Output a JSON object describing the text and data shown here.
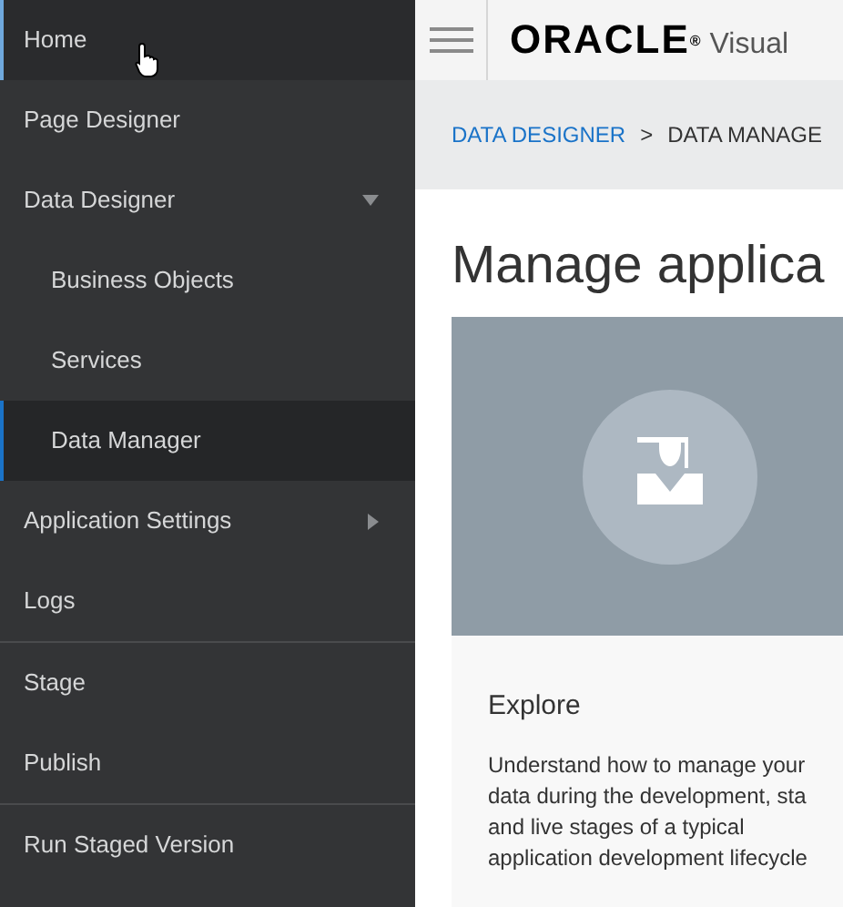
{
  "sidebar": {
    "groups": [
      [
        {
          "label": "Home",
          "hovered": true,
          "selected": false
        },
        {
          "label": "Page Designer",
          "hovered": false,
          "selected": false
        },
        {
          "label": "Data Designer",
          "hovered": false,
          "selected": false,
          "expanded": true,
          "children": [
            {
              "label": "Business Objects",
              "hovered": false,
              "selected": false
            },
            {
              "label": "Services",
              "hovered": false,
              "selected": false
            },
            {
              "label": "Data Manager",
              "hovered": false,
              "selected": true
            }
          ]
        },
        {
          "label": "Application Settings",
          "hovered": false,
          "selected": false,
          "expanded": false
        },
        {
          "label": "Logs",
          "hovered": false,
          "selected": false
        }
      ],
      [
        {
          "label": "Stage",
          "hovered": false,
          "selected": false
        },
        {
          "label": "Publish",
          "hovered": false,
          "selected": false
        }
      ],
      [
        {
          "label": "Run Staged Version",
          "hovered": false,
          "selected": false
        }
      ]
    ]
  },
  "header": {
    "logo": "ORACLE",
    "logo_mark": "®",
    "product": "Visual"
  },
  "breadcrumb": [
    {
      "label": "DATA DESIGNER",
      "kind": "link"
    },
    {
      "label": ">",
      "kind": "separator"
    },
    {
      "label": "DATA MANAGE",
      "kind": "current"
    }
  ],
  "page_title": "Manage applica",
  "card": {
    "title": "Explore",
    "lines": [
      "Understand how to manage your",
      "data during the development, sta",
      "and live stages of a typical",
      "application development lifecycle"
    ]
  }
}
